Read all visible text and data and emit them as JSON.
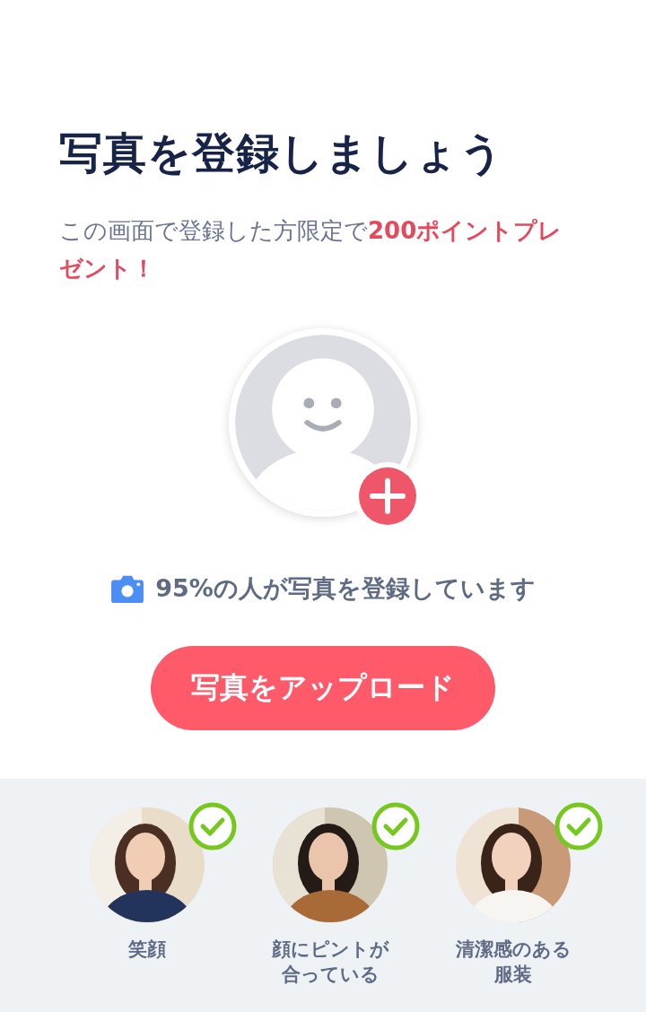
{
  "title": "写真を登録しましょう",
  "subtitle": "この画面で登録した方限定で**200ポイントプレゼント！**",
  "avatar": {
    "add_badge": true
  },
  "stat": "95%の人が写真を登録しています",
  "upload_button": "写真をアップロード",
  "tips": [
    {
      "label": "笑顔",
      "checked": true,
      "kind": "picture"
    },
    {
      "label": "顔にピントが合っている",
      "checked": true,
      "kind": "picture"
    },
    {
      "label": "清潔感のある服装",
      "checked": true,
      "kind": "picture"
    }
  ]
}
